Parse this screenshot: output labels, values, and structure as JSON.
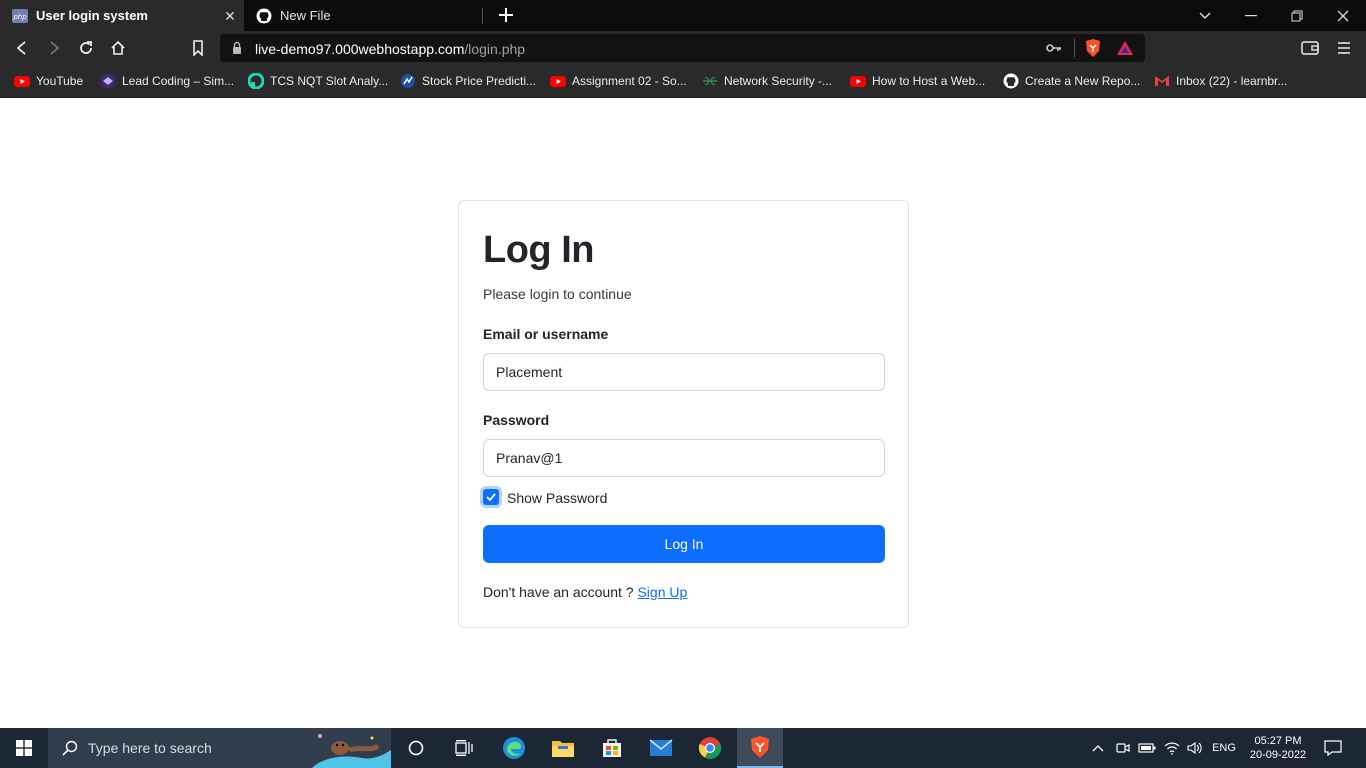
{
  "browser": {
    "tabs": [
      {
        "title": "User login system",
        "favicon": "php-icon",
        "active": true
      },
      {
        "title": "New File",
        "favicon": "github-icon",
        "active": false
      }
    ],
    "url_host": "live-demo97.000webhostapp.com",
    "url_path": "/login.php",
    "bookmarks": [
      {
        "label": "YouTube",
        "icon": "youtube-icon"
      },
      {
        "label": "Lead Coding – Sim...",
        "icon": "leadcoding-icon"
      },
      {
        "label": "TCS NQT Slot Analy...",
        "icon": "tcs-icon"
      },
      {
        "label": "Stock Price Predicti...",
        "icon": "stock-icon"
      },
      {
        "label": "Assignment 02 - So...",
        "icon": "youtube-icon"
      },
      {
        "label": "Network Security -...",
        "icon": "gfg-icon"
      },
      {
        "label": "How to Host a Web...",
        "icon": "youtube-icon"
      },
      {
        "label": "Create a New Repo...",
        "icon": "github-icon"
      },
      {
        "label": "Inbox (22) - learnbr...",
        "icon": "gmail-icon"
      }
    ]
  },
  "login": {
    "heading": "Log In",
    "subtitle": "Please login to continue",
    "email_label": "Email or username",
    "email_value": "Placement",
    "password_label": "Password",
    "password_value": "Pranav@1",
    "show_password_label": "Show Password",
    "show_password_checked": true,
    "submit_label": "Log In",
    "signup_prompt": "Don't have an account ?",
    "signup_link": "Sign Up"
  },
  "taskbar": {
    "search_placeholder": "Type here to search",
    "language": "ENG",
    "time": "05:27 PM",
    "date": "20-09-2022"
  },
  "colors": {
    "primary": "#0d6efd",
    "browser_dark": "#2a2a2a",
    "taskbar": "#1b2735"
  }
}
